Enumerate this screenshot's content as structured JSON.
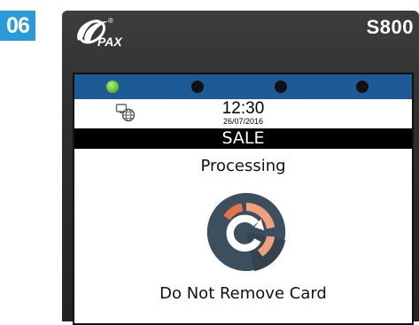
{
  "step": {
    "number": "06"
  },
  "device": {
    "brand": "PAX",
    "model": "S800",
    "registered_mark": "®"
  },
  "screen": {
    "leds": [
      {
        "state": "on",
        "color": "#5fc12e"
      },
      {
        "state": "off",
        "color": "#111111"
      },
      {
        "state": "off",
        "color": "#111111"
      },
      {
        "state": "off",
        "color": "#111111"
      }
    ],
    "status": {
      "network_icon": "network-globe-icon",
      "time": "12:30",
      "date": "26/07/2016"
    },
    "transaction_type": "SALE",
    "message": "Processing",
    "spinner_icon": "processing-spinner-icon",
    "instruction": "Do Not Remove Card"
  },
  "colors": {
    "step_badge": "#2b9ad8",
    "led_bar": "#1e5a96",
    "terminal_body": "#2f2f2f",
    "spinner_bg": "#3b4f5e",
    "spinner_accent": "#e8704a",
    "spinner_secondary": "#f2a07c"
  }
}
